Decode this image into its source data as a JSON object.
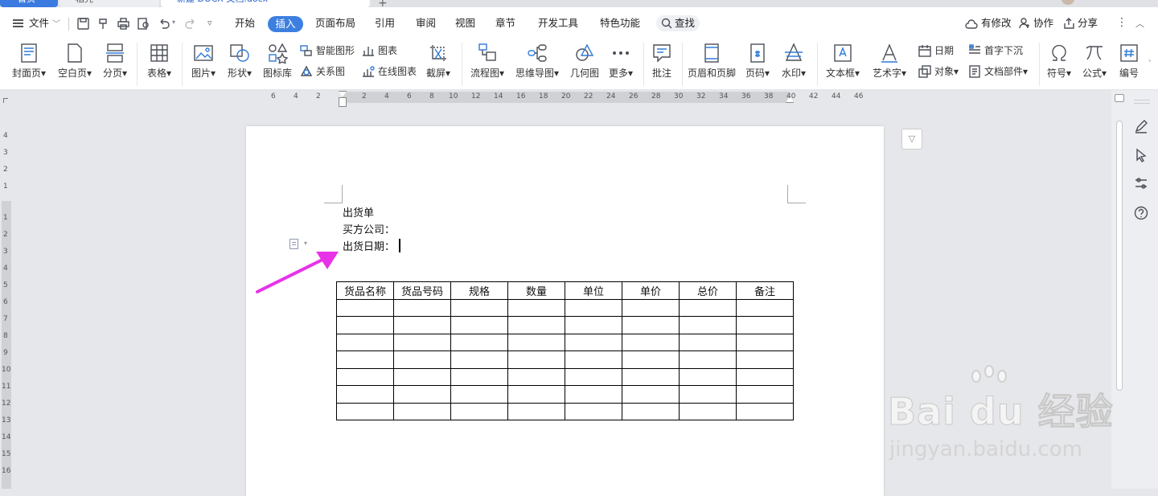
{
  "tabs": [
    {
      "label": "首页"
    },
    {
      "label": "稻壳"
    },
    {
      "label": "新建 DOCX 文档.docx"
    }
  ],
  "menu": {
    "file": "文件",
    "items": [
      "开始",
      "插入",
      "页面布局",
      "引用",
      "审阅",
      "视图",
      "章节",
      "开发工具",
      "特色功能"
    ],
    "active": "插入",
    "search": "查找",
    "modified": "有修改",
    "collab": "协作",
    "share": "分享"
  },
  "ribbon": {
    "cover": "封面页",
    "blank": "空白页",
    "pagebreak": "分页",
    "table": "表格",
    "picture": "图片",
    "shape": "形状",
    "iconlib": "图标库",
    "smartart": "智能图形",
    "relation": "关系图",
    "chart": "图表",
    "onlinechart": "在线图表",
    "screenshot": "截屏",
    "flowchart": "流程图",
    "mindmap": "思维导图",
    "geometry": "几何图",
    "more": "更多",
    "comment": "批注",
    "headerfooter": "页眉和页脚",
    "pagenum": "页码",
    "watermark": "水印",
    "textbox": "文本框",
    "wordart": "艺术字",
    "date": "日期",
    "object": "对象",
    "dropcap": "首字下沉",
    "docparts": "文档部件",
    "symbol": "符号",
    "formula": "公式",
    "numbering": "编号"
  },
  "ruler": {
    "left_ticks": [
      "6",
      "4",
      "2"
    ],
    "ticks": [
      "2",
      "4",
      "6",
      "8",
      "10",
      "12",
      "14",
      "16",
      "18",
      "20",
      "22",
      "24",
      "26",
      "28",
      "30",
      "32",
      "34",
      "36",
      "38",
      "40",
      "42",
      "44",
      "46"
    ],
    "vticks_top": [
      "4",
      "3",
      "2",
      "1"
    ],
    "vticks": [
      "1",
      "2",
      "3",
      "4",
      "5",
      "6",
      "7",
      "8",
      "9",
      "10",
      "11",
      "12",
      "13",
      "14",
      "15",
      "16"
    ]
  },
  "document": {
    "lines": [
      "出货单",
      "买方公司：",
      "出货日期："
    ],
    "table_headers": [
      "货品名称",
      "货品号码",
      "规格",
      "数量",
      "单位",
      "单价",
      "总价",
      "备注"
    ],
    "empty_rows": 7
  },
  "watermark": {
    "logo": "Bai du 经验",
    "url": "jingyan.baidu.com"
  },
  "colors": {
    "accent": "#3d7fe0",
    "arrow": "#e832e8"
  }
}
